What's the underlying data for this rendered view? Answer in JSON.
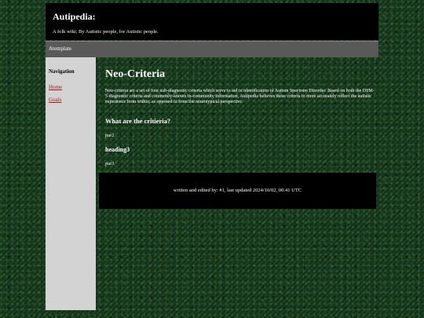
{
  "header": {
    "title": "Autipedia:",
    "tagline": "A folk wiki; By Autistic people, for Autistic people."
  },
  "nav": {
    "link_label": "Atemplate"
  },
  "sidebar": {
    "title": "Navigation",
    "items": [
      {
        "label": "Home"
      },
      {
        "label": "Goals"
      }
    ]
  },
  "article": {
    "title": "Neo-Criteria",
    "intro": "Neo-criteria are a set of four sub-diagnostic criteria which serve to aid in identification of Autism Spectrum Disorder. Based on both the DSM-5 diagnostic criteria and commonly-known in-community information, Autipedia believes these criteria to more accurately reflect the autistic experience from within, as opposed to from the neurotypical perspective.",
    "heading2": "What are the critieria?",
    "par2": "par2",
    "heading3": "heading3",
    "par3": "par3"
  },
  "footer": {
    "text": "written and edited by: #1, last updated 2024/10/02, 00:41 UTC"
  },
  "colors": {
    "header_bg": "#000000",
    "nav_bg": "#595959",
    "sidebar_bg": "#d3d3d3",
    "link": "#a01818",
    "background": "#17351c"
  }
}
